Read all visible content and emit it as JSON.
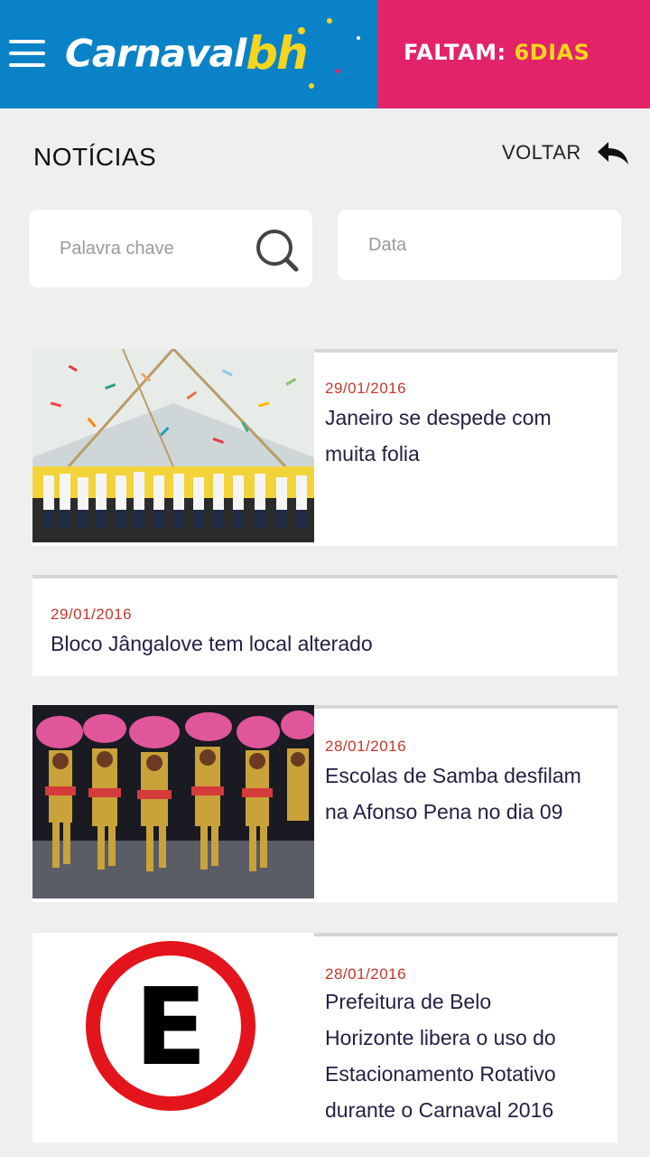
{
  "header": {
    "logo_text": "Carnaval",
    "logo_accent": "bh",
    "countdown_label": "FALTAM: ",
    "countdown_value": "6DIAS",
    "left_color": "#0a82c8",
    "right_color": "#e2236a",
    "accent_color": "#f7d51d"
  },
  "page": {
    "title": "NOTÍCIAS",
    "back_label": "VOLTAR"
  },
  "filters": {
    "keyword_placeholder": "Palavra chave",
    "date_placeholder": "Data"
  },
  "news": [
    {
      "date": "29/01/2016",
      "title_lines": [
        "Janeiro se despede com",
        "muita folia"
      ],
      "image": "confetti-band-photo"
    },
    {
      "date": "29/01/2016",
      "title": "Bloco Jângalove tem local alterado"
    },
    {
      "date": "28/01/2016",
      "title_lines": [
        "Escolas de Samba desfilam",
        "na Afonso Pena no dia 09"
      ],
      "image": "samba-dancers-photo"
    },
    {
      "date": "28/01/2016",
      "title_lines": [
        "Prefeitura de Belo",
        "Horizonte libera o uso do",
        "Estacionamento Rotativo",
        "durante o Carnaval 2016"
      ],
      "image": "parking-sign",
      "sign_letter": "E"
    }
  ],
  "colors": {
    "date": "#c0392b",
    "title": "#222244",
    "background": "#efefef"
  }
}
